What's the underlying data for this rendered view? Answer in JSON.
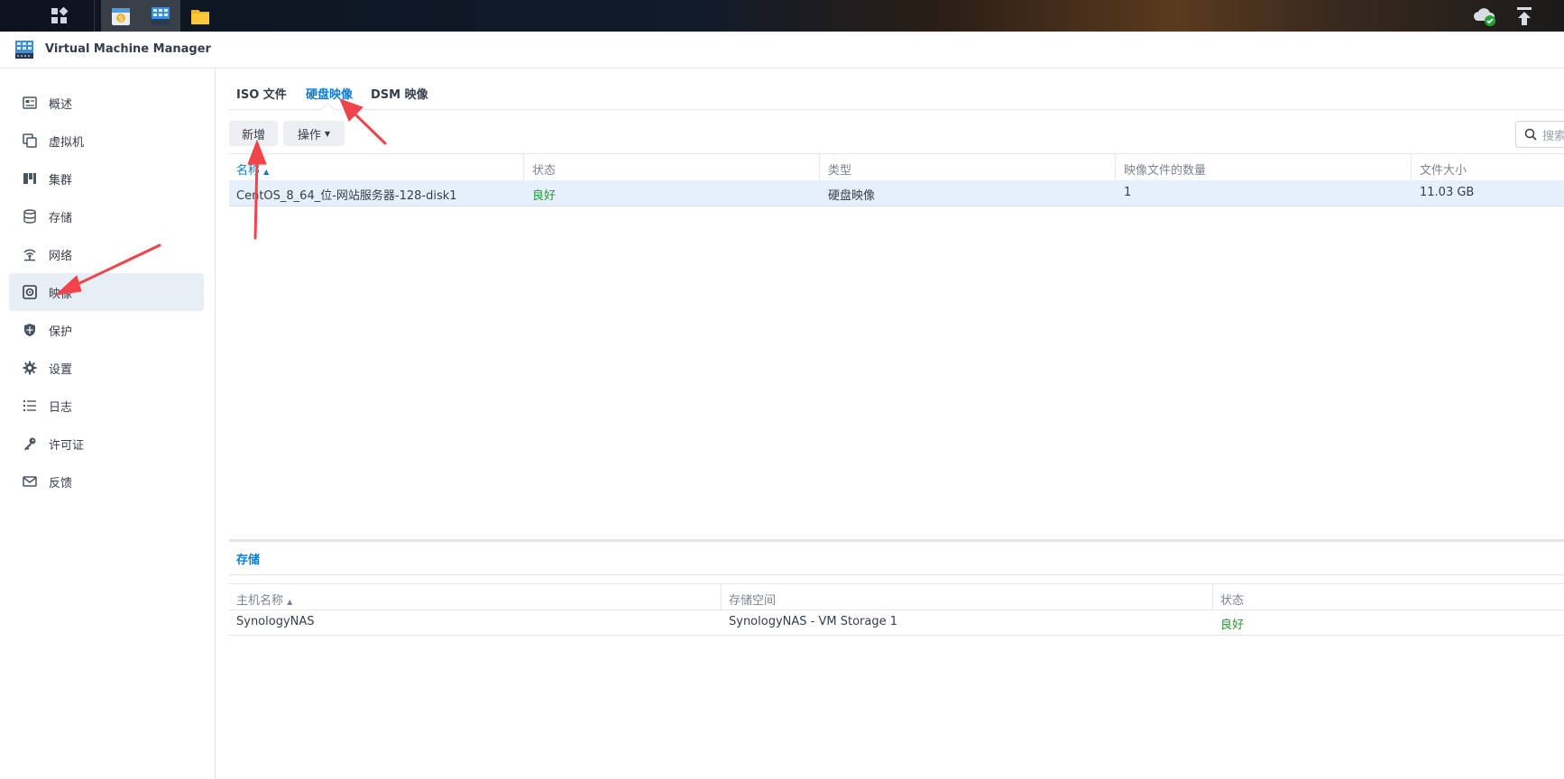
{
  "taskbar": {
    "apps": [
      "main-menu-icon",
      "package-center-icon",
      "vmm-app-icon",
      "file-station-icon"
    ],
    "right": [
      "cloud-sync-icon",
      "upload-icon"
    ]
  },
  "app": {
    "title": "Virtual Machine Manager"
  },
  "sidebar": {
    "items": [
      {
        "label": "概述",
        "icon": "overview-icon"
      },
      {
        "label": "虚拟机",
        "icon": "vm-icon"
      },
      {
        "label": "集群",
        "icon": "cluster-icon"
      },
      {
        "label": "存储",
        "icon": "storage-icon"
      },
      {
        "label": "网络",
        "icon": "network-icon"
      },
      {
        "label": "映像",
        "icon": "image-icon"
      },
      {
        "label": "保护",
        "icon": "shield-icon"
      },
      {
        "label": "设置",
        "icon": "gear-icon"
      },
      {
        "label": "日志",
        "icon": "log-icon"
      },
      {
        "label": "许可证",
        "icon": "key-icon"
      },
      {
        "label": "反馈",
        "icon": "mail-icon"
      }
    ],
    "active_index": 5
  },
  "tabs": [
    {
      "label": "ISO 文件"
    },
    {
      "label": "硬盘映像"
    },
    {
      "label": "DSM 映像"
    }
  ],
  "active_tab": 1,
  "toolbar": {
    "add_label": "新增",
    "action_label": "操作",
    "search_placeholder": "搜索"
  },
  "table": {
    "columns": [
      "名称",
      "状态",
      "类型",
      "映像文件的数量",
      "文件大小"
    ],
    "rows": [
      [
        "CentOS_8_64_位-网站服务器-128-disk1",
        "良好",
        "硬盘映像",
        "1",
        "11.03 GB"
      ]
    ]
  },
  "storage_panel": {
    "tab_label": "存储",
    "columns": [
      "主机名称",
      "存储空间",
      "状态"
    ],
    "rows": [
      [
        "SynologyNAS",
        "SynologyNAS - VM Storage 1",
        "良好"
      ]
    ]
  },
  "colors": {
    "accent": "#0a7bd6",
    "good": "#1d9c2f",
    "arrow": "#f0444a",
    "selected_row": "#e6f0fa"
  }
}
